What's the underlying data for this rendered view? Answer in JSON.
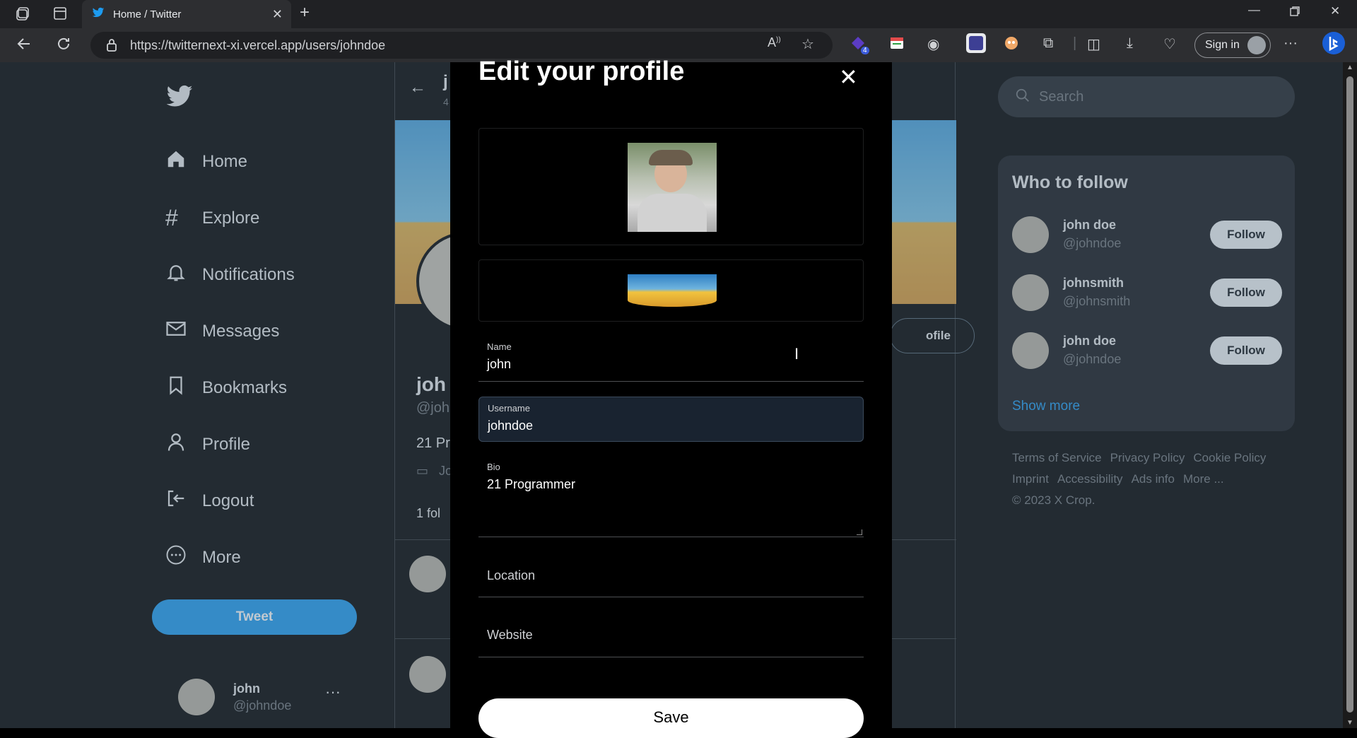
{
  "browser": {
    "tab_title": "Home / Twitter",
    "url": "https://twitternext-xi.vercel.app/users/johndoe",
    "signin_label": "Sign in",
    "extension_badge": "4"
  },
  "sidebar": {
    "items": [
      {
        "label": "Home",
        "icon": "home-icon"
      },
      {
        "label": "Explore",
        "icon": "hashtag-icon"
      },
      {
        "label": "Notifications",
        "icon": "bell-icon"
      },
      {
        "label": "Messages",
        "icon": "mail-icon"
      },
      {
        "label": "Bookmarks",
        "icon": "bookmark-icon"
      },
      {
        "label": "Profile",
        "icon": "user-icon"
      },
      {
        "label": "Logout",
        "icon": "logout-icon"
      },
      {
        "label": "More",
        "icon": "more-circle-icon"
      }
    ],
    "tweet_label": "Tweet",
    "account": {
      "name": "john",
      "handle": "@johndoe"
    }
  },
  "main": {
    "partial_title": "j",
    "partial_count": "4",
    "name_partial": "joh",
    "handle_partial": "@joh",
    "bio_partial": "21 Pr",
    "joined_partial": "Jo",
    "follow_partial": "1 fol",
    "edit_profile_partial": "ofile"
  },
  "right": {
    "search_placeholder": "Search",
    "who_to_follow_title": "Who to follow",
    "suggestions": [
      {
        "name": "john doe",
        "handle": "@johndoe",
        "button": "Follow"
      },
      {
        "name": "johnsmith",
        "handle": "@johnsmith",
        "button": "Follow"
      },
      {
        "name": "john doe",
        "handle": "@johndoe",
        "button": "Follow"
      }
    ],
    "show_more": "Show more",
    "footer": {
      "links": [
        "Terms of Service",
        "Privacy Policy",
        "Cookie Policy",
        "Imprint",
        "Accessibility",
        "Ads info",
        "More ..."
      ],
      "copyright": "© 2023 X Crop."
    }
  },
  "modal": {
    "title": "Edit your profile",
    "name_label": "Name",
    "name_value": "john",
    "username_label": "Username",
    "username_value": "johndoe",
    "bio_label": "Bio",
    "bio_value": "21 Programmer",
    "location_placeholder": "Location",
    "website_placeholder": "Website",
    "save_label": "Save"
  },
  "colors": {
    "accent": "#1d9bf0",
    "background": "#000000",
    "overlay": "#5b7083"
  }
}
